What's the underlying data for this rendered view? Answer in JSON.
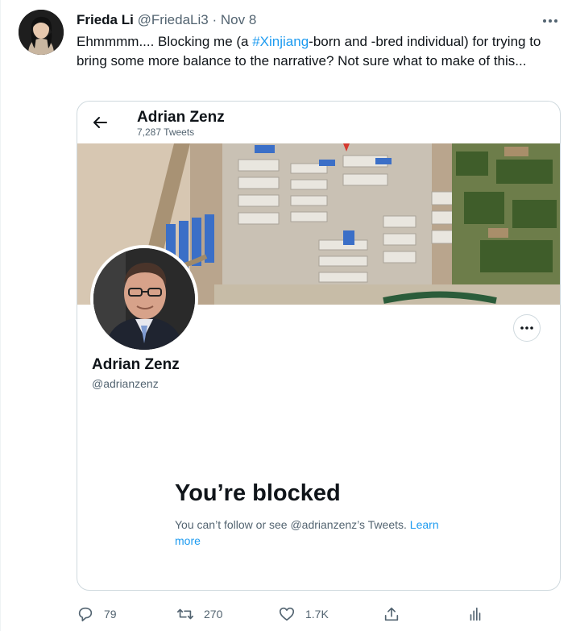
{
  "tweet": {
    "author_name": "Frieda Li",
    "author_handle": "@FriedaLi3",
    "separator": "·",
    "date": "Nov 8",
    "text_before": "Ehmmmm.... Blocking me (a ",
    "hashtag": "#Xinjiang",
    "text_after": "-born and -bred individual) for trying to bring some more balance to the narrative? Not sure what to make of this..."
  },
  "card": {
    "profile_name": "Adrian Zenz",
    "tweet_count": "7,287 Tweets",
    "display_name": "Adrian Zenz",
    "handle": "@adrianzenz",
    "blocked_heading": "You’re blocked",
    "blocked_text": "You can’t follow or see @adrianzenz’s Tweets. ",
    "learn_more": "Learn more"
  },
  "actions": {
    "reply_count": "79",
    "retweet_count": "270",
    "like_count": "1.7K"
  },
  "icons": {
    "more": "more-dots-icon",
    "back": "back-arrow-icon",
    "reply": "reply-icon",
    "retweet": "retweet-icon",
    "like": "heart-icon",
    "share": "share-icon",
    "analytics": "analytics-icon"
  },
  "colors": {
    "accent": "#1d9bf0",
    "text": "#0f1419",
    "secondary": "#536471",
    "border": "#cfd9de"
  }
}
